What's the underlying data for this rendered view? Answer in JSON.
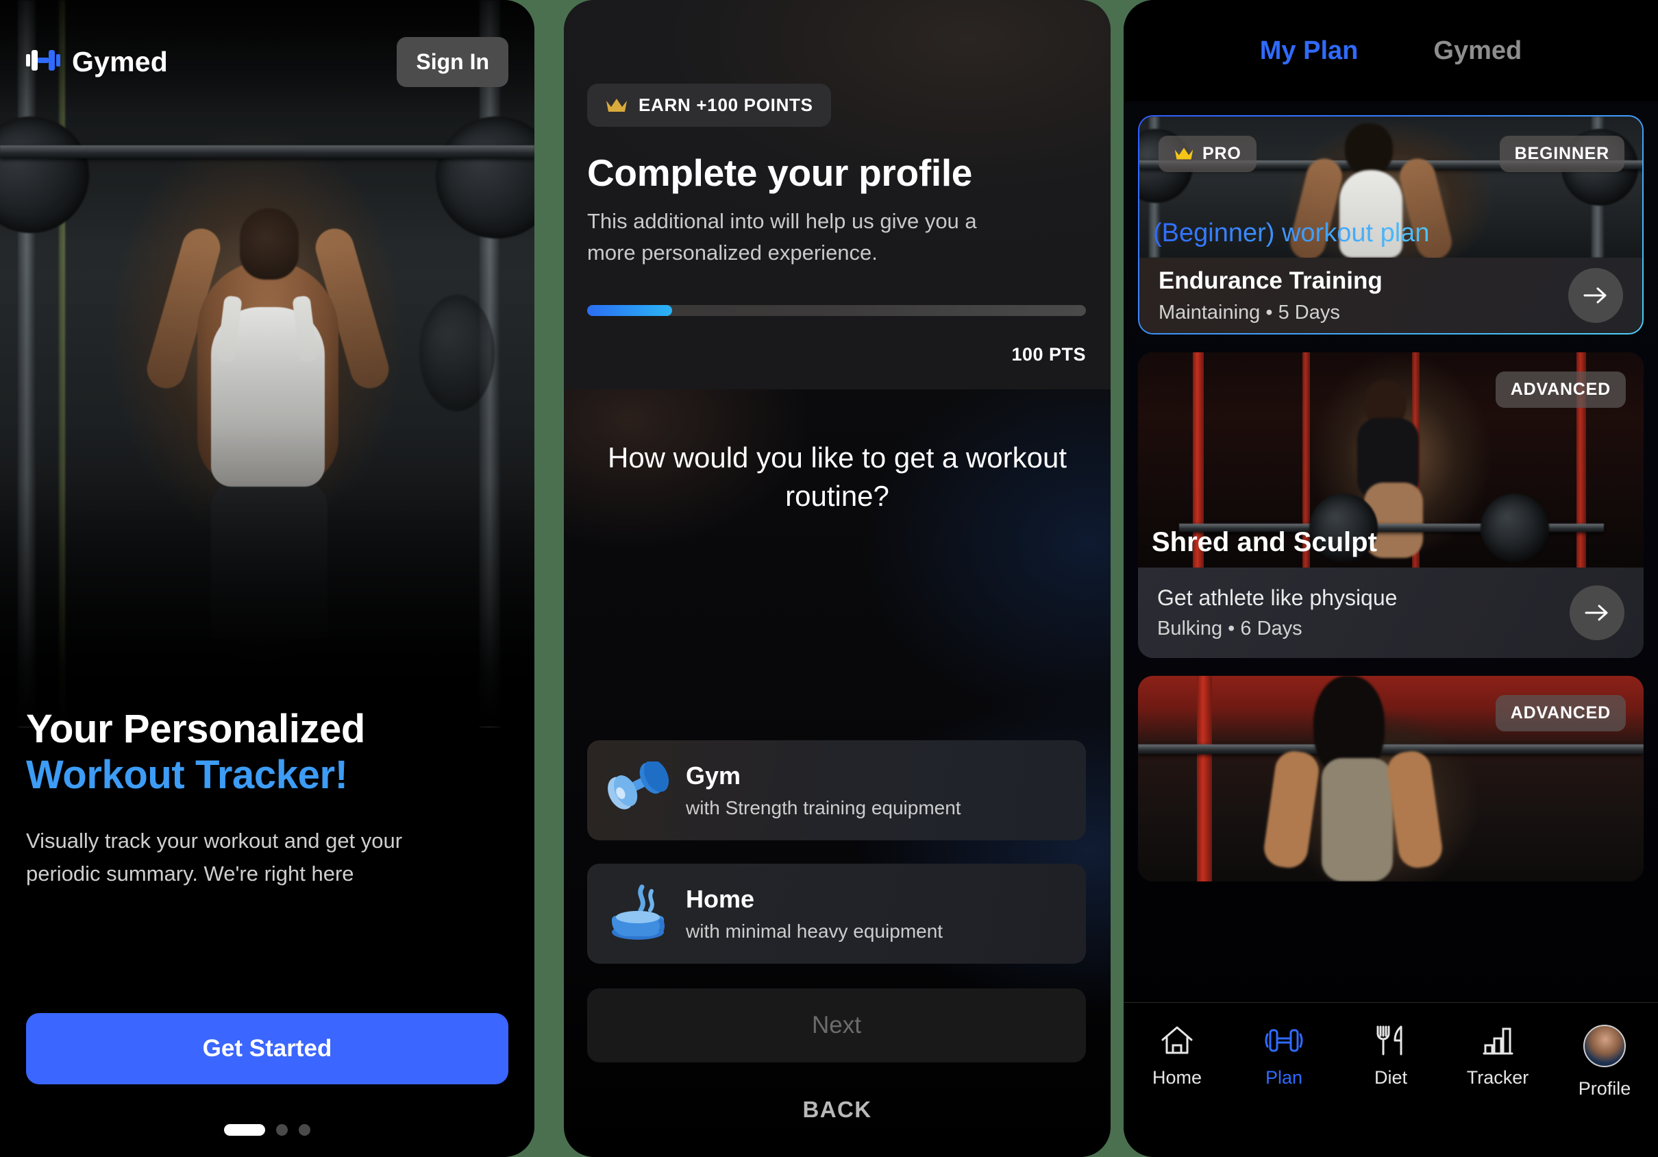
{
  "theme": {
    "accent_blue": "#3b66ff",
    "accent_cyan": "#4fc3f7",
    "gold": "#f5c518",
    "background_green": "#4a7050"
  },
  "onboarding": {
    "brand": "Gymed",
    "logo_icon": "dumbbell-icon",
    "sign_in_label": "Sign In",
    "headline_line1": "Your Personalized",
    "headline_line2": "Workout Tracker!",
    "description": "Visually track your workout and get your periodic summary. We're right here",
    "cta_label": "Get Started",
    "pager": {
      "total": 3,
      "active": 1
    }
  },
  "profile_step": {
    "points_badge": {
      "icon": "crown-icon",
      "label": "EARN +100 POINTS"
    },
    "title": "Complete your profile",
    "subtitle": "This additional into will help us give you a more personalized experience.",
    "progress_percent": 17,
    "points_value": "100 PTS",
    "question": "How would you like to get a workout routine?",
    "options": [
      {
        "icon": "dumbbell-3d-icon",
        "title": "Gym",
        "subtitle": "with Strength training equipment"
      },
      {
        "icon": "teacup-3d-icon",
        "title": "Home",
        "subtitle": "with minimal heavy equipment"
      }
    ],
    "next_label": "Next",
    "back_label": "BACK"
  },
  "plan_screen": {
    "tabs": [
      {
        "label": "My Plan",
        "active": true
      },
      {
        "label": "Gymed",
        "active": false
      }
    ],
    "cards": [
      {
        "pro_badge": "PRO",
        "pro_icon": "crown-icon",
        "level_badge": "BEGINNER",
        "overlay_title": "(Beginner) workout plan",
        "title": "Endurance Training",
        "meta": "Maintaining • 5 Days",
        "arrow_icon": "arrow-right-icon",
        "selected": true
      },
      {
        "level_badge": "ADVANCED",
        "overlay_title": "Shred and Sculpt",
        "title": "Get athlete like physique",
        "meta": "Bulking • 6 Days",
        "arrow_icon": "arrow-right-icon",
        "selected": false
      },
      {
        "level_badge": "ADVANCED",
        "selected": false
      }
    ],
    "bottom_nav": [
      {
        "icon": "home-icon",
        "label": "Home",
        "active": false
      },
      {
        "icon": "dumbbell-icon",
        "label": "Plan",
        "active": true
      },
      {
        "icon": "cutlery-icon",
        "label": "Diet",
        "active": false
      },
      {
        "icon": "chart-icon",
        "label": "Tracker",
        "active": false
      },
      {
        "icon": "avatar-icon",
        "label": "Profile",
        "active": false
      }
    ]
  }
}
